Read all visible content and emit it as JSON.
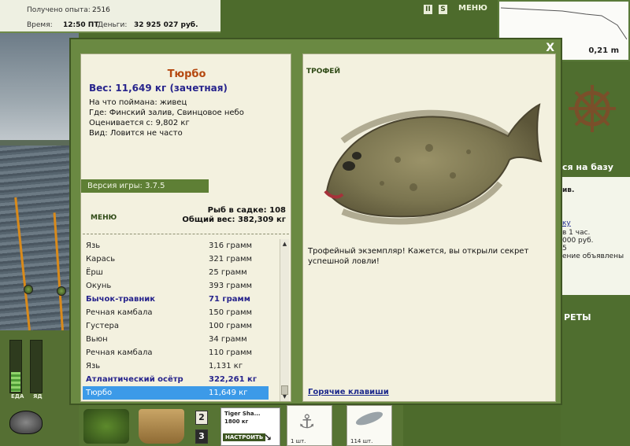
{
  "hud": {
    "exp_label": "Получено опыта:",
    "exp_value": "2516",
    "time_label": "Время:",
    "time_value": "12:50 ПТ",
    "money_label": "Деньги:",
    "money_value": "32 925 027 руб.",
    "menu_label": "МЕНЮ",
    "btn_pause": "II",
    "btn_s": "S"
  },
  "depth": {
    "value": "0,21 m"
  },
  "right_panel": {
    "base_text": "ся на базу",
    "line1": "ив.",
    "line2": "ку",
    "line3": "в 1 час.",
    "line4": "000 руб.",
    "line5": "5",
    "line6": "ение объявлены",
    "secrets": "РЕТЫ"
  },
  "bars": {
    "food_label": "ЕДА",
    "poison_label": "ЯД",
    "food_level": 0.38,
    "poison_level": 0
  },
  "bottom": {
    "slot2": "2",
    "slot3": "3",
    "tackle_name": "Tiger Sha...",
    "tackle_weight": "1800 кг",
    "tackle_btn": "НАСТРОИТЬ",
    "item1_count": "1 шт.",
    "item2_count": "114 шт."
  },
  "dialog": {
    "close": "X",
    "fish_name": "Тюрбо",
    "fish_weight": "Вес: 11,649 кг (зачетная)",
    "caught_on": "На что поймана: живец",
    "where": "Где: Финский залив, Свинцовое небо",
    "valued_from": "Оценивается с: 9,802 кг",
    "kind": "Вид: Ловится не часто",
    "version": "Версия игры: 3.7.5",
    "menu_btn": "МЕНЮ",
    "fish_in_keepnet": "Рыб в садке: 108",
    "total_weight": "Общий вес: 382,309 кг",
    "trophy_label": "ТРОФЕЙ",
    "trophy_text": "Трофейный экземпляр! Кажется, вы открыли секрет успешной ловли!",
    "hotkeys": "Горячие клавиши",
    "fish_list": [
      {
        "name": "Язь",
        "weight": "316 грамм",
        "style": ""
      },
      {
        "name": "Карась",
        "weight": "321 грамм",
        "style": ""
      },
      {
        "name": "Ёрш",
        "weight": "25 грамм",
        "style": ""
      },
      {
        "name": "Окунь",
        "weight": "393 грамм",
        "style": ""
      },
      {
        "name": "Бычок-травник",
        "weight": "71 грамм",
        "style": "bold"
      },
      {
        "name": "Речная камбала",
        "weight": "150 грамм",
        "style": ""
      },
      {
        "name": "Густера",
        "weight": "100 грамм",
        "style": ""
      },
      {
        "name": "Вьюн",
        "weight": "34 грамм",
        "style": ""
      },
      {
        "name": "Речная камбала",
        "weight": "110 грамм",
        "style": ""
      },
      {
        "name": "Язь",
        "weight": "1,131 кг",
        "style": ""
      },
      {
        "name": "Атлантический осётр",
        "weight": "322,261 кг",
        "style": "bold"
      },
      {
        "name": "Тюрбо",
        "weight": "11,649 кг",
        "style": "sel"
      }
    ]
  }
}
